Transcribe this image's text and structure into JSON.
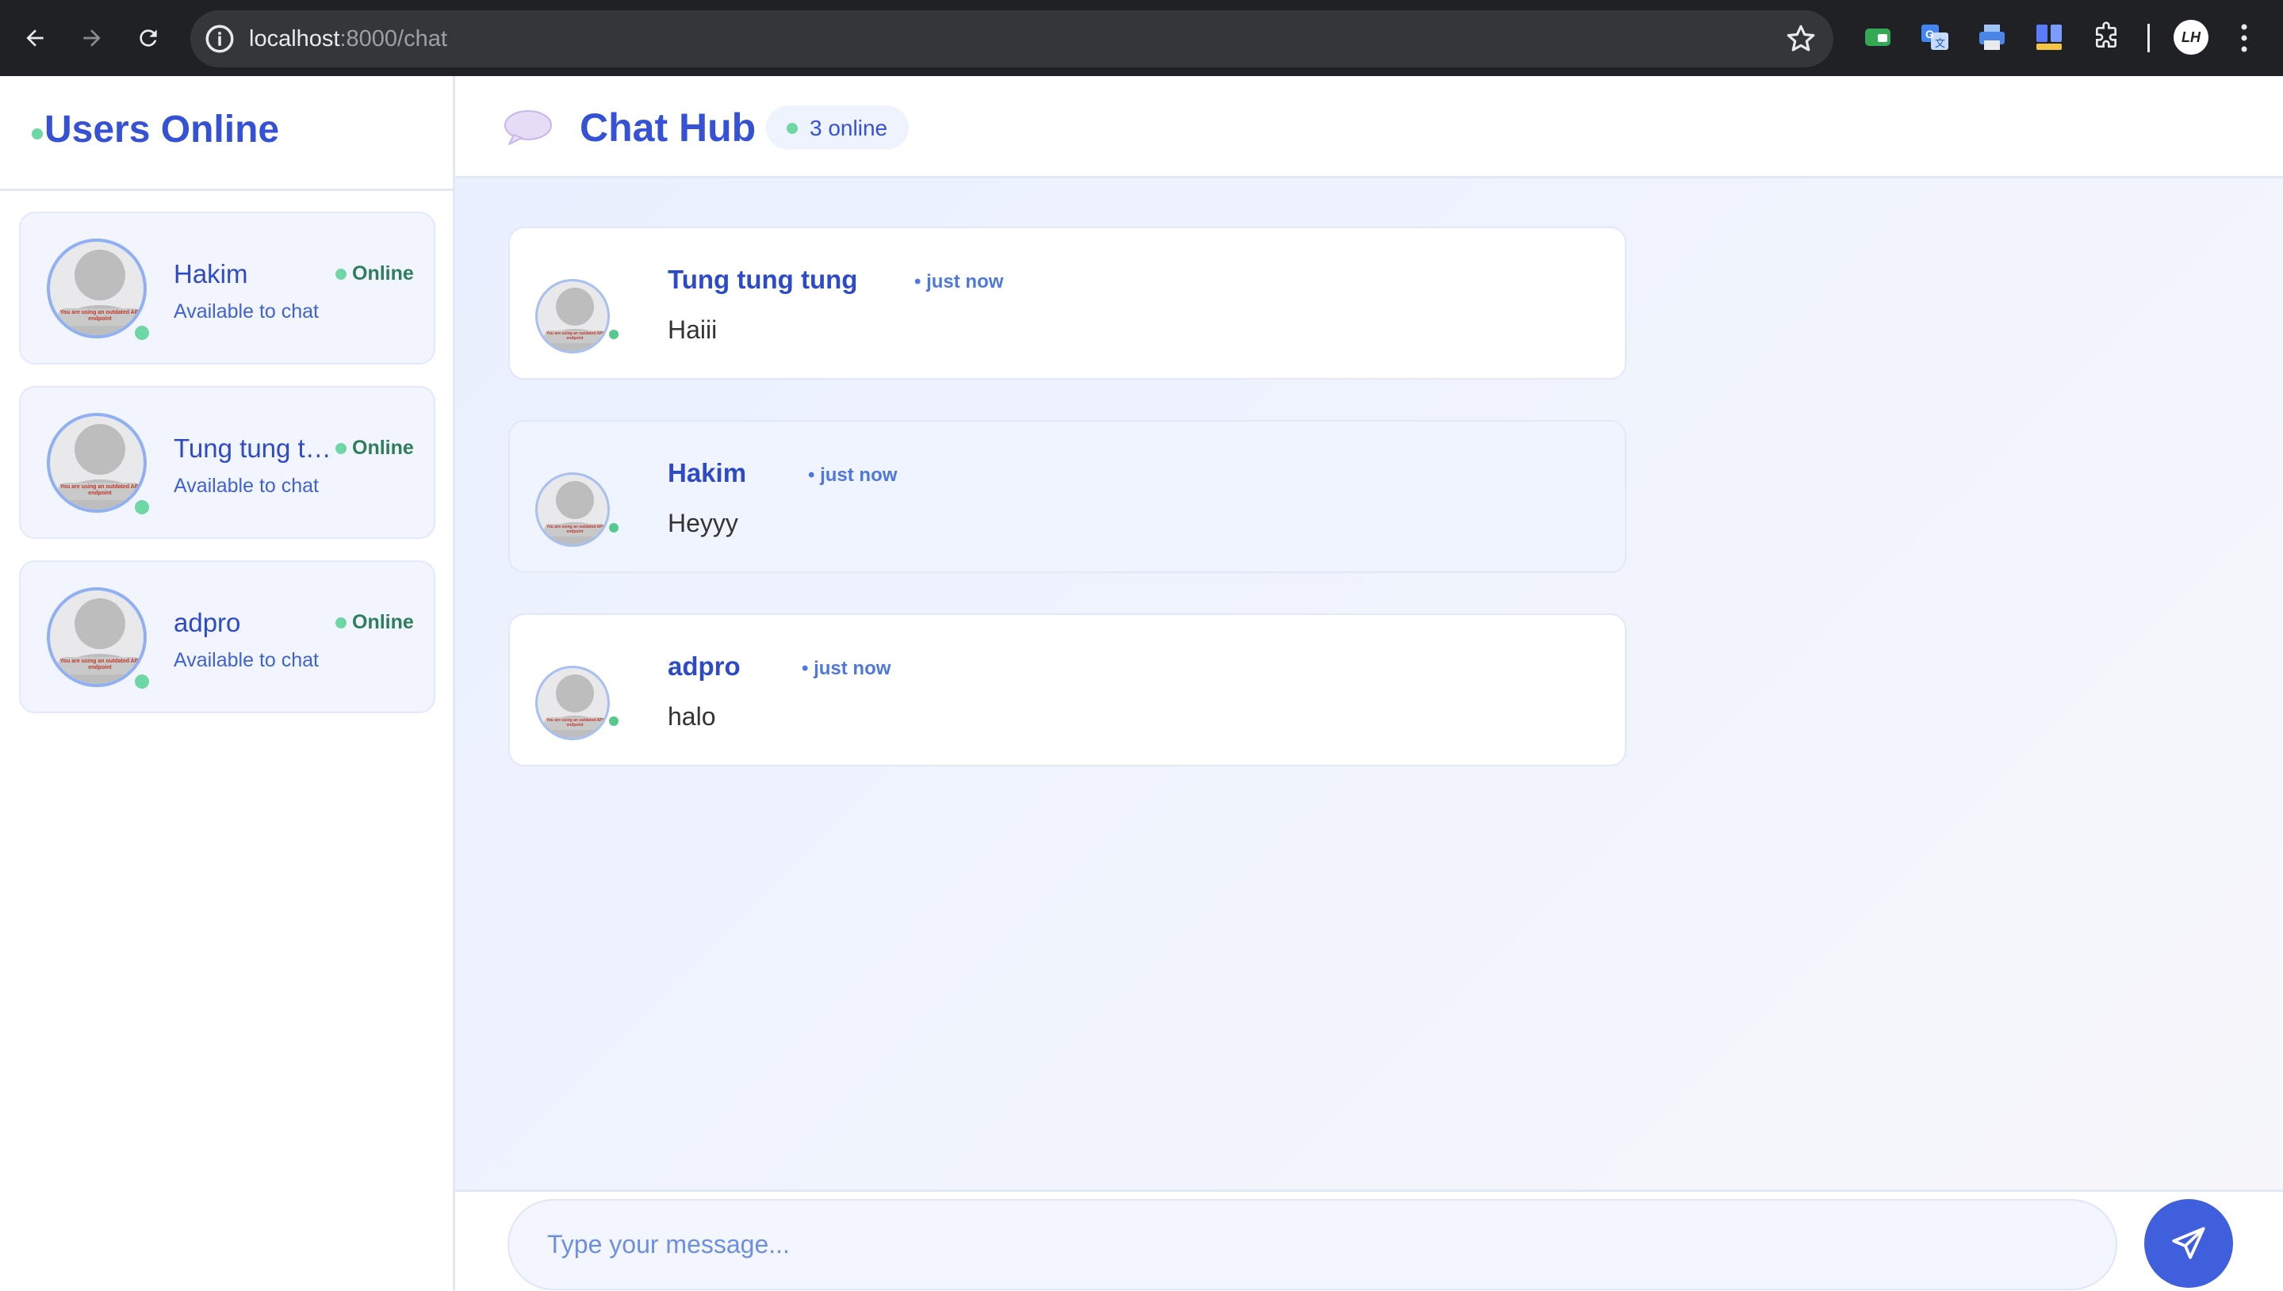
{
  "browser": {
    "url_host": "localhost",
    "url_rest": ":8000/chat",
    "profile_initials": "LH"
  },
  "sidebar": {
    "title": "Users Online",
    "users": [
      {
        "name": "Hakim",
        "status": "Online",
        "subtitle": "Available to chat",
        "avatar_note": "You are using an outdated API endpoint"
      },
      {
        "name": "Tung tung tung",
        "status": "Online",
        "subtitle": "Available to chat",
        "avatar_note": "You are using an outdated API endpoint"
      },
      {
        "name": "adpro",
        "status": "Online",
        "subtitle": "Available to chat",
        "avatar_note": "You are using an outdated API endpoint"
      }
    ]
  },
  "header": {
    "title": "Chat Hub",
    "online_count": "3 online"
  },
  "messages": [
    {
      "author": "Tung tung tung",
      "time": "• just now",
      "text": "Haiii"
    },
    {
      "author": "Hakim",
      "time": "• just now",
      "text": "Heyyy"
    },
    {
      "author": "adpro",
      "time": "• just now",
      "text": "halo"
    }
  ],
  "composer": {
    "placeholder": "Type your message..."
  },
  "colors": {
    "accent": "#3552d6",
    "online": "#6fd6a6",
    "send_button": "#3f5fdc"
  }
}
